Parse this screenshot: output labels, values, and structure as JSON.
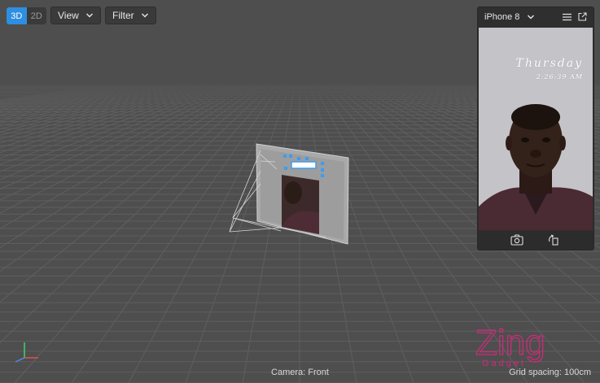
{
  "toolbar": {
    "mode_3d": "3D",
    "mode_2d": "2D",
    "view_label": "View",
    "filter_label": "Filter"
  },
  "device_panel": {
    "device_name": "iPhone 8",
    "lock_day": "Thursday",
    "lock_time": "2:26:39 AM"
  },
  "status": {
    "camera": "Camera: Front",
    "grid_spacing": "Grid spacing: 100cm"
  },
  "watermark": {
    "brand": "Zing",
    "sub": "Gadget"
  },
  "colors": {
    "accent": "#2e8ee0",
    "viewport_bg": "#4e4e4e",
    "grid_line": "#5e5e5e",
    "logo": "#d6287c"
  },
  "icons": {
    "dropdown": "chevron-down-icon",
    "menu": "hamburger-menu-icon",
    "popout": "external-link-icon",
    "camera": "camera-switch-icon",
    "rotate": "rotate-icon"
  }
}
